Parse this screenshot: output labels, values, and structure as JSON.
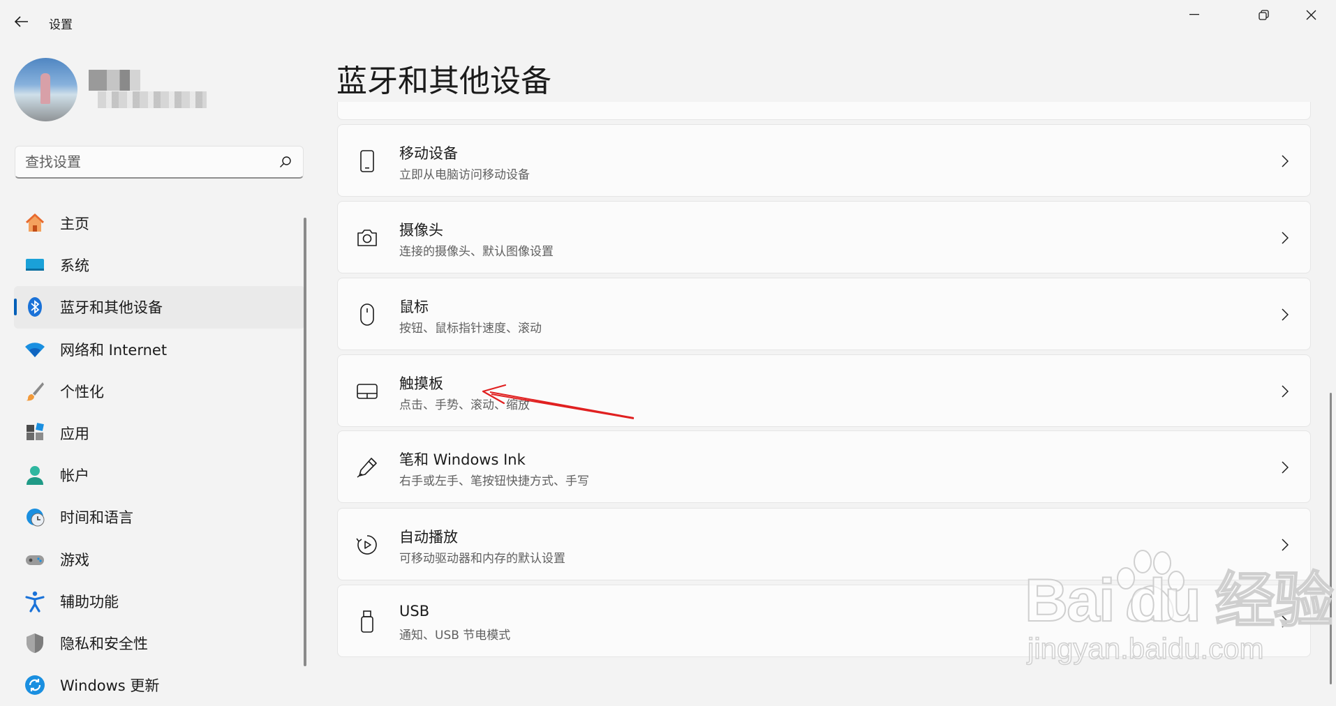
{
  "window": {
    "app_title": "设置"
  },
  "search": {
    "placeholder": "查找设置"
  },
  "nav": {
    "items": [
      {
        "label": "主页",
        "icon": "home-icon"
      },
      {
        "label": "系统",
        "icon": "system-icon"
      },
      {
        "label": "蓝牙和其他设备",
        "icon": "bluetooth-icon",
        "selected": true
      },
      {
        "label": "网络和 Internet",
        "icon": "wifi-icon"
      },
      {
        "label": "个性化",
        "icon": "brush-icon"
      },
      {
        "label": "应用",
        "icon": "apps-icon"
      },
      {
        "label": "帐户",
        "icon": "account-icon"
      },
      {
        "label": "时间和语言",
        "icon": "time-language-icon"
      },
      {
        "label": "游戏",
        "icon": "gaming-icon"
      },
      {
        "label": "辅助功能",
        "icon": "accessibility-icon"
      },
      {
        "label": "隐私和安全性",
        "icon": "shield-icon"
      },
      {
        "label": "Windows 更新",
        "icon": "update-icon"
      }
    ]
  },
  "main": {
    "page_title": "蓝牙和其他设备",
    "cards": [
      {
        "title": "移动设备",
        "subtitle": "立即从电脑访问移动设备",
        "icon": "phone-icon"
      },
      {
        "title": "摄像头",
        "subtitle": "连接的摄像头、默认图像设置",
        "icon": "camera-icon"
      },
      {
        "title": "鼠标",
        "subtitle": "按钮、鼠标指针速度、滚动",
        "icon": "mouse-icon"
      },
      {
        "title": "触摸板",
        "subtitle": "点击、手势、滚动、缩放",
        "icon": "touchpad-icon"
      },
      {
        "title": "笔和 Windows Ink",
        "subtitle": "右手或左手、笔按钮快捷方式、手写",
        "icon": "pen-icon"
      },
      {
        "title": "自动播放",
        "subtitle": "可移动驱动器和内存的默认设置",
        "icon": "autoplay-icon"
      },
      {
        "title": "USB",
        "subtitle": "通知、USB 节电模式",
        "icon": "usb-icon"
      }
    ]
  },
  "watermark": {
    "brand": "Bai  du 经验",
    "url": "jingyan.baidu.com"
  },
  "colors": {
    "accent": "#005fb8",
    "annotation_arrow": "#e02020"
  }
}
